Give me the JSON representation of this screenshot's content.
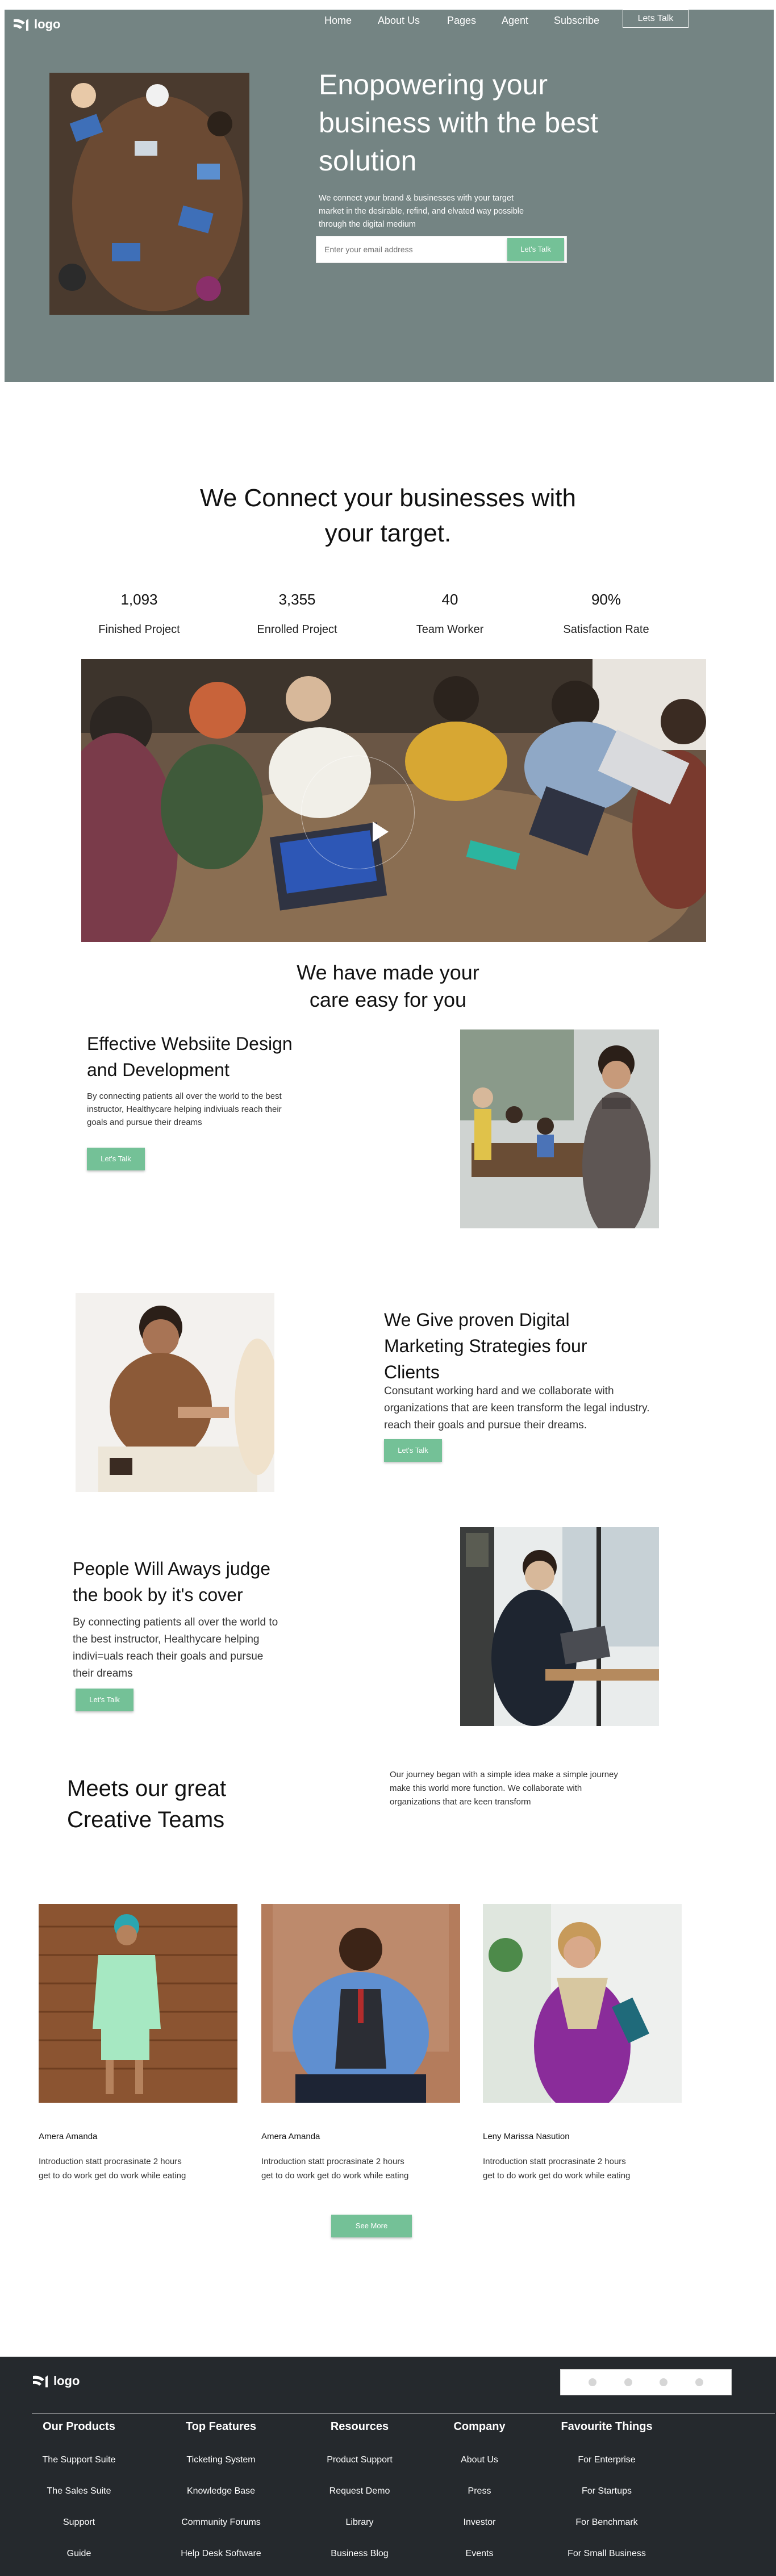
{
  "nav": {
    "logo": "logo",
    "links": [
      "Home",
      "About Us",
      "Pages",
      "Agent",
      "Subscribe"
    ],
    "cta": "Lets Talk"
  },
  "hero": {
    "title_line1": "Enopowering your",
    "title_line2": "business with the best",
    "title_line3": "solution",
    "subtitle_line1": "We connect your brand & businesses with your target",
    "subtitle_line2": "market in the desirable, refind, and elvated way possible",
    "subtitle_line3": "through the digital medium",
    "email_placeholder": "Enter your email address",
    "cta": "Let's Talk"
  },
  "connect": {
    "title_line1": "We Connect your businesses with",
    "title_line2": "your target.",
    "stats": [
      {
        "value": "1,093",
        "label": "Finished Project"
      },
      {
        "value": "3,355",
        "label": "Enrolled Project"
      },
      {
        "value": "40",
        "label": "Team Worker"
      },
      {
        "value": "90%",
        "label": "Satisfaction Rate"
      }
    ]
  },
  "care": {
    "title_line1": "We have made your",
    "title_line2": "care easy for you"
  },
  "features": [
    {
      "title_line1": "Effective Websiite Design",
      "title_line2": "and Development",
      "text_line1": "By connecting patients all over the world to the best",
      "text_line2": "instructor, Healthycare helping indiviuals reach their",
      "text_line3": "goals and pursue their dreams",
      "cta": "Let's Talk"
    },
    {
      "title_line1": "We Give proven Digital",
      "title_line2": "Marketing Strategies four",
      "title_line3": "Clients",
      "text_line1": "Consutant working hard and we collaborate with",
      "text_line2": "organizations that are keen transform the legal industry.",
      "text_line3": "reach their goals and pursue their dreams.",
      "cta": "Let's Talk"
    },
    {
      "title_line1": "People Will Aways judge",
      "title_line2": "the book by it's cover",
      "text_line1": "By connecting patients all over the world to",
      "text_line2": "the best instructor, Healthycare helping",
      "text_line3": "indivi=uals reach their goals and pursue",
      "text_line4": "their dreams",
      "cta": "Let's Talk"
    }
  ],
  "team": {
    "title_line1": "Meets our great",
    "title_line2": "Creative Teams",
    "intro_line1": "Our journey began with a simple idea make a simple journey",
    "intro_line2": "make this world more function. We collaborate with",
    "intro_line3": "organizations that are keen transform",
    "members": [
      {
        "name": "Amera Amanda",
        "text_line1": "Introduction statt procrasinate 2 hours",
        "text_line2": "get to do work get do work while eating"
      },
      {
        "name": "Amera Amanda",
        "text_line1": "Introduction statt procrasinate 2 hours",
        "text_line2": "get to do work get do work while eating"
      },
      {
        "name": "Leny Marissa Nasution",
        "text_line1": "Introduction statt procrasinate 2 hours",
        "text_line2": "get to do work get do work while eating"
      }
    ],
    "cta": "See More"
  },
  "footer": {
    "logo": "logo",
    "columns": [
      {
        "title": "Our Products",
        "items": [
          "The Support Suite",
          "The Sales Suite",
          "Support",
          "Guide"
        ]
      },
      {
        "title": "Top Features",
        "items": [
          "Ticketing System",
          "Knowledge Base",
          "Community Forums",
          "Help Desk Software"
        ]
      },
      {
        "title": "Resources",
        "items": [
          "Product Support",
          "Request Demo",
          "Library",
          "Business Blog"
        ]
      },
      {
        "title": "Company",
        "items": [
          "About Us",
          "Press",
          "Investor",
          "Events"
        ]
      },
      {
        "title": "Favourite Things",
        "items": [
          "For Enterprise",
          "For Startups",
          "For Benchmark",
          "For Small Business"
        ]
      }
    ]
  },
  "colors": {
    "hero_bg": "#748483",
    "accent_green": "#74c197",
    "footer_bg": "#25292d"
  }
}
